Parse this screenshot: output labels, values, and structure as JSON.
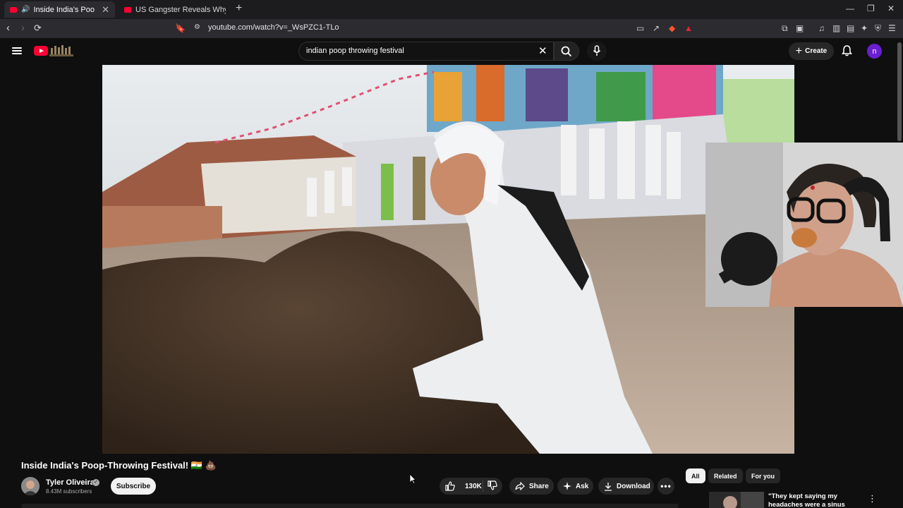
{
  "browser": {
    "tabs": [
      {
        "title": "Inside India's Poop-Throwing",
        "active": true,
        "audio": true
      },
      {
        "title": "US Gangster Reveals Why MUSLIMS",
        "active": false,
        "audio": false
      }
    ],
    "url": "youtube.com/watch?v=_WsPZC1-TLo"
  },
  "header": {
    "search_value": "indian poop throwing festival",
    "create_label": "Create",
    "avatar_letter": "n"
  },
  "video": {
    "title": "Inside India's Poop-Throwing Festival! 🇮🇳 💩",
    "channel": "Tyler Oliveira",
    "subscribers": "8.43M subscribers",
    "subscribe_label": "Subscribe",
    "likes": "130K",
    "share_label": "Share",
    "ask_label": "Ask",
    "download_label": "Download"
  },
  "chips": [
    "All",
    "Related",
    "For you"
  ],
  "recommendation": {
    "title": "\"They kept saying my headaches were a sinus"
  },
  "colors": {
    "youtube_red": "#ff0033",
    "background": "#0f0f0f",
    "avatar": "#6a1fd1"
  }
}
